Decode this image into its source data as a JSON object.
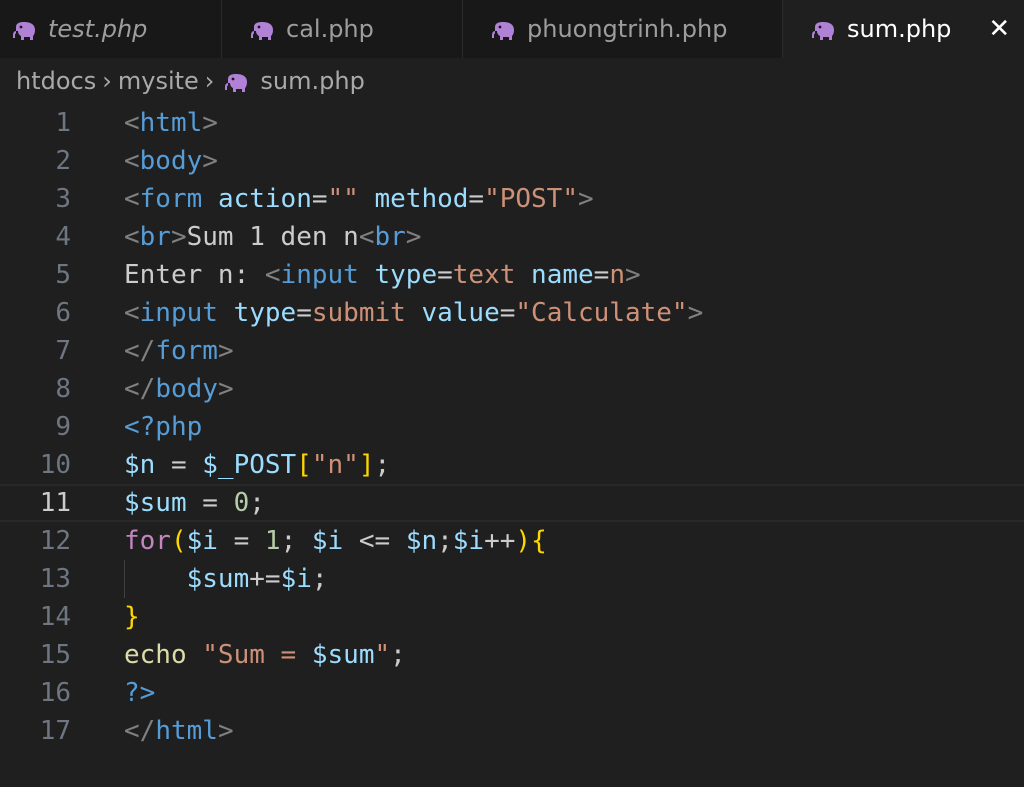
{
  "colors": {
    "tag_bracket": "#808080",
    "tag_name": "#569cd6",
    "attr_name": "#9cdcfe",
    "string": "#ce9178",
    "text": "#cccccc",
    "variable": "#9cdcfe",
    "keyword": "#c586c0",
    "function": "#dcdcaa",
    "number": "#b5cea8",
    "bracket_gold": "#ffd700",
    "bracket_purple": "#da70d6",
    "php_icon": "#b181d6"
  },
  "tabs": [
    {
      "label": "test.php",
      "icon": "php-elephant-icon",
      "italic": true,
      "active": false
    },
    {
      "label": "cal.php",
      "icon": "php-elephant-icon",
      "italic": false,
      "active": false
    },
    {
      "label": "phuongtrinh.php",
      "icon": "php-elephant-icon",
      "italic": false,
      "active": false
    },
    {
      "label": "sum.php",
      "icon": "php-elephant-icon",
      "italic": false,
      "active": true,
      "close": "✕"
    }
  ],
  "breadcrumb": {
    "items": [
      "htdocs",
      "mysite",
      "sum.php"
    ],
    "separator": "›"
  },
  "editor": {
    "current_line": 11,
    "lines": [
      {
        "n": "1",
        "tokens": [
          [
            "<",
            "tag_bracket"
          ],
          [
            "html",
            "tag_name"
          ],
          [
            ">",
            "tag_bracket"
          ]
        ]
      },
      {
        "n": "2",
        "tokens": [
          [
            "<",
            "tag_bracket"
          ],
          [
            "body",
            "tag_name"
          ],
          [
            ">",
            "tag_bracket"
          ]
        ]
      },
      {
        "n": "3",
        "tokens": [
          [
            "<",
            "tag_bracket"
          ],
          [
            "form",
            "tag_name"
          ],
          [
            " ",
            "text"
          ],
          [
            "action",
            "attr_name"
          ],
          [
            "=",
            "text"
          ],
          [
            "\"\"",
            "string"
          ],
          [
            " ",
            "text"
          ],
          [
            "method",
            "attr_name"
          ],
          [
            "=",
            "text"
          ],
          [
            "\"POST\"",
            "string"
          ],
          [
            ">",
            "tag_bracket"
          ]
        ]
      },
      {
        "n": "4",
        "tokens": [
          [
            "<",
            "tag_bracket"
          ],
          [
            "br",
            "tag_name"
          ],
          [
            ">",
            "tag_bracket"
          ],
          [
            "Sum 1 den n",
            "text"
          ],
          [
            "<",
            "tag_bracket"
          ],
          [
            "br",
            "tag_name"
          ],
          [
            ">",
            "tag_bracket"
          ]
        ]
      },
      {
        "n": "5",
        "tokens": [
          [
            "Enter n: ",
            "text"
          ],
          [
            "<",
            "tag_bracket"
          ],
          [
            "input",
            "tag_name"
          ],
          [
            " ",
            "text"
          ],
          [
            "type",
            "attr_name"
          ],
          [
            "=",
            "text"
          ],
          [
            "text",
            "string"
          ],
          [
            " ",
            "text"
          ],
          [
            "name",
            "attr_name"
          ],
          [
            "=",
            "text"
          ],
          [
            "n",
            "string"
          ],
          [
            ">",
            "tag_bracket"
          ]
        ]
      },
      {
        "n": "6",
        "tokens": [
          [
            "<",
            "tag_bracket"
          ],
          [
            "input",
            "tag_name"
          ],
          [
            " ",
            "text"
          ],
          [
            "type",
            "attr_name"
          ],
          [
            "=",
            "text"
          ],
          [
            "submit",
            "string"
          ],
          [
            " ",
            "text"
          ],
          [
            "value",
            "attr_name"
          ],
          [
            "=",
            "text"
          ],
          [
            "\"Calculate\"",
            "string"
          ],
          [
            ">",
            "tag_bracket"
          ]
        ]
      },
      {
        "n": "7",
        "tokens": [
          [
            "</",
            "tag_bracket"
          ],
          [
            "form",
            "tag_name"
          ],
          [
            ">",
            "tag_bracket"
          ]
        ]
      },
      {
        "n": "8",
        "tokens": [
          [
            "</",
            "tag_bracket"
          ],
          [
            "body",
            "tag_name"
          ],
          [
            ">",
            "tag_bracket"
          ]
        ]
      },
      {
        "n": "9",
        "tokens": [
          [
            "<?php",
            "tag_name"
          ]
        ]
      },
      {
        "n": "10",
        "tokens": [
          [
            "$n",
            "variable"
          ],
          [
            " = ",
            "text"
          ],
          [
            "$_POST",
            "variable"
          ],
          [
            "[",
            "bracket_gold"
          ],
          [
            "\"n\"",
            "string"
          ],
          [
            "]",
            "bracket_gold"
          ],
          [
            ";",
            "text"
          ]
        ]
      },
      {
        "n": "11",
        "tokens": [
          [
            "$sum",
            "variable"
          ],
          [
            " = ",
            "text"
          ],
          [
            "0",
            "number"
          ],
          [
            ";",
            "text"
          ]
        ]
      },
      {
        "n": "12",
        "tokens": [
          [
            "for",
            "keyword"
          ],
          [
            "(",
            "bracket_gold"
          ],
          [
            "$i",
            "variable"
          ],
          [
            " = ",
            "text"
          ],
          [
            "1",
            "number"
          ],
          [
            "; ",
            "text"
          ],
          [
            "$i",
            "variable"
          ],
          [
            " <= ",
            "text"
          ],
          [
            "$n",
            "variable"
          ],
          [
            ";",
            "text"
          ],
          [
            "$i",
            "variable"
          ],
          [
            "++",
            "text"
          ],
          [
            ")",
            "bracket_gold"
          ],
          [
            "{",
            "bracket_gold"
          ]
        ]
      },
      {
        "n": "13",
        "tokens": [
          [
            "    ",
            "text"
          ],
          [
            "$sum",
            "variable"
          ],
          [
            "+=",
            "text"
          ],
          [
            "$i",
            "variable"
          ],
          [
            ";",
            "text"
          ]
        ],
        "indent_guide": true
      },
      {
        "n": "14",
        "tokens": [
          [
            "}",
            "bracket_gold"
          ]
        ]
      },
      {
        "n": "15",
        "tokens": [
          [
            "echo",
            "function"
          ],
          [
            " ",
            "text"
          ],
          [
            "\"Sum = ",
            "string"
          ],
          [
            "$sum",
            "variable"
          ],
          [
            "\"",
            "string"
          ],
          [
            ";",
            "text"
          ]
        ]
      },
      {
        "n": "16",
        "tokens": [
          [
            "?>",
            "tag_name"
          ]
        ]
      },
      {
        "n": "17",
        "tokens": [
          [
            "</",
            "tag_bracket"
          ],
          [
            "html",
            "tag_name"
          ],
          [
            ">",
            "tag_bracket"
          ]
        ]
      }
    ]
  }
}
